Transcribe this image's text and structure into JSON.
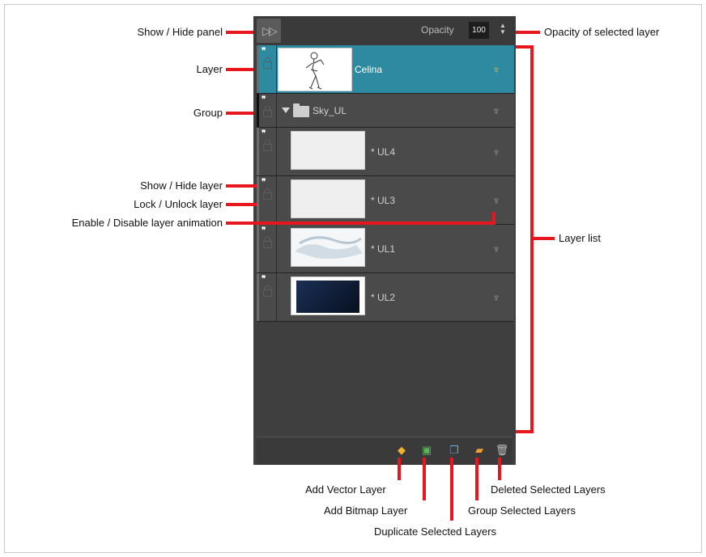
{
  "panel": {
    "opacity_label": "Opacity",
    "opacity_value": "100",
    "layers": [
      {
        "name": "Celina",
        "type": "drawing",
        "selected": true
      },
      {
        "name": "Sky_UL",
        "type": "group",
        "expanded": true
      },
      {
        "name": "* UL4",
        "type": "drawing"
      },
      {
        "name": "* UL3",
        "type": "drawing"
      },
      {
        "name": "* UL1",
        "type": "drawing"
      },
      {
        "name": "* UL2",
        "type": "drawing"
      }
    ],
    "icons": {
      "show_hide_panel": "double-chevron-right-icon",
      "eye": "eye-icon",
      "lock": "lock-icon",
      "animation": "stick-figure-icon",
      "add_vector": "add-vector-layer-icon",
      "add_bitmap": "add-bitmap-layer-icon",
      "duplicate": "duplicate-layers-icon",
      "group": "group-layers-icon",
      "delete": "trash-icon"
    },
    "colors": {
      "selected_row": "#2d8aa0",
      "panel_bg": "#3f3f3f",
      "annotation_red": "#e8171f"
    }
  },
  "annotations": {
    "show_hide_panel": "Show / Hide panel",
    "opacity_of_selected_layer": "Opacity of selected layer",
    "layer": "Layer",
    "group": "Group",
    "show_hide_layer": "Show / Hide layer",
    "lock_unlock_layer": "Lock /  Unlock layer",
    "enable_disable_animation": "Enable / Disable layer animation",
    "layer_list": "Layer list",
    "add_vector_layer": "Add Vector Layer",
    "add_bitmap_layer": "Add Bitmap Layer",
    "duplicate_selected_layers": "Duplicate Selected Layers",
    "group_selected_layers": "Group Selected Layers",
    "deleted_selected_layers": "Deleted Selected Layers"
  }
}
